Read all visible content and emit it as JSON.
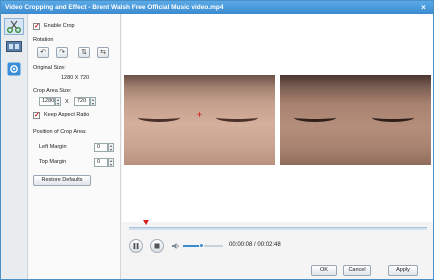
{
  "window": {
    "title": "Video Cropping and Effect - Brent Walsh  Free Official Music video.mp4"
  },
  "tools": [
    {
      "icon": "scissors-icon"
    },
    {
      "icon": "filmstrip-icon"
    },
    {
      "icon": "effect-gear-icon"
    }
  ],
  "crop": {
    "enable_label": "Enable Crop",
    "rotation_label": "Rotation",
    "original_size_label": "Original Size:",
    "original_size_value": "1280 X 720",
    "crop_area_label": "Crop Area Size:",
    "crop_width": "1280",
    "crop_x": "X",
    "crop_height": "720",
    "keep_aspect_label": "Keep Aspect Ratio",
    "position_label": "Position of Crop Area:",
    "left_margin_label": "Left Margin",
    "left_margin_value": "0",
    "top_margin_label": "Top Margin",
    "top_margin_value": "0",
    "restore_label": "Restore Defaults"
  },
  "player": {
    "time": "00:00:08 / 00:02:48",
    "progress": 0.06,
    "volume": 0.45
  },
  "footer": {
    "ok": "OK",
    "cancel": "Cancel",
    "apply": "Apply"
  },
  "colors": {
    "accent": "#3b8bd0",
    "crop_marker": "#d02020"
  }
}
